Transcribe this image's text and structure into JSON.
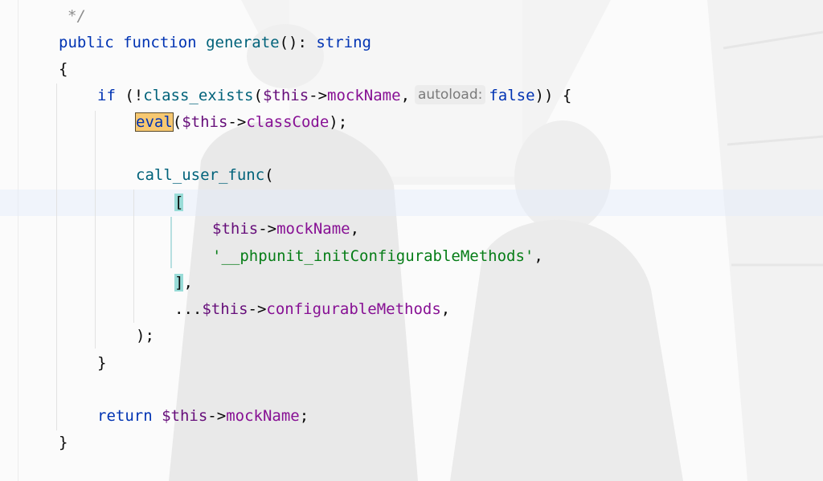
{
  "colors": {
    "keyword": "#0033b3",
    "function": "#00627a",
    "variable": "#660e7a",
    "property": "#871094",
    "string": "#067d17",
    "comment": "#8c8c8c",
    "highlight": "#f7c871",
    "bracket_match": "#99dcd8"
  },
  "code": {
    "comment_end": "*/",
    "l_public": "public",
    "l_function": "function",
    "l_generate": "generate",
    "l_sig_rest": "(): ",
    "l_string": "string",
    "open_brace": "{",
    "if_kw": "if",
    "if_open": " (!",
    "class_exists": "class_exists",
    "paren": "(",
    "this1": "$this",
    "arrow1": "->",
    "mockName1": "mockName",
    "comma1": ",",
    "hint_autoload": "autoload:",
    "false_kw": "false",
    "if_close": ")) {",
    "eval_kw": "eval",
    "eval_paren": "(",
    "this2": "$this",
    "arrow2": "->",
    "classCode": "classCode",
    "eval_end": ");",
    "call_user_func": "call_user_func",
    "cuf_paren": "(",
    "bracket_open": "[",
    "this3": "$this",
    "arrow3": "->",
    "mockName3": "mockName",
    "comma3": ",",
    "init_str": "'__phpunit_initConfigurableMethods'",
    "comma4": ",",
    "bracket_close": "]",
    "comma5": ",",
    "spread": "...",
    "this4": "$this",
    "arrow4": "->",
    "configurableMethods": "configurableMethods",
    "comma6": ",",
    "call_close": ");",
    "if_close_brace": "}",
    "return_kw": "return",
    "this5": "$this",
    "arrow5": "->",
    "mockName5": "mockName",
    "semi5": ";",
    "close_brace": "}"
  }
}
